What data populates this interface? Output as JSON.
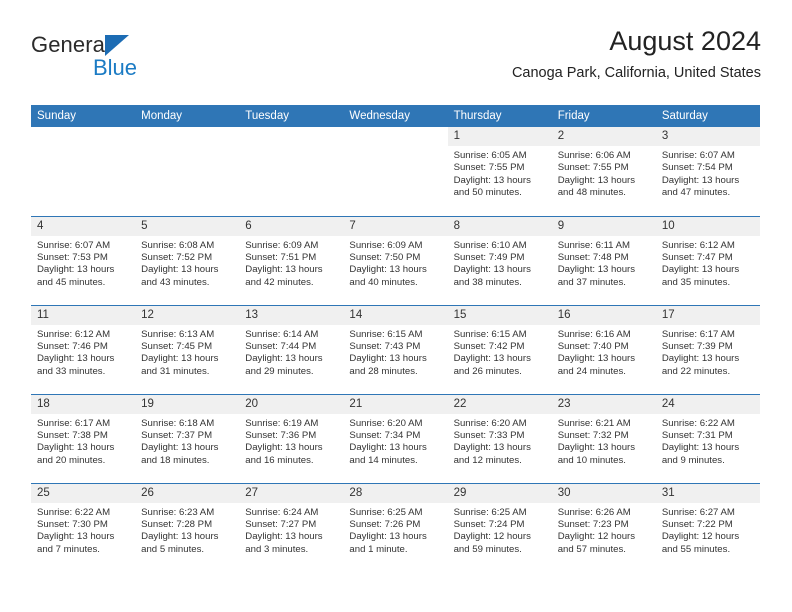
{
  "brand": {
    "name_part1": "General",
    "name_part2": "Blue",
    "triangle_color": "#1c6cb4",
    "blue_color": "#1b7bc4"
  },
  "header": {
    "title": "August 2024",
    "subtitle": "Canoga Park, California, United States"
  },
  "theme": {
    "header_bg": "#2f76b6",
    "daynum_bg": "#f0f0f0",
    "rule_color": "#2f76b6",
    "text_color": "#333333"
  },
  "weekday_headers": [
    "Sunday",
    "Monday",
    "Tuesday",
    "Wednesday",
    "Thursday",
    "Friday",
    "Saturday"
  ],
  "weeks": [
    [
      {
        "day": "",
        "empty": true,
        "sunrise": "",
        "sunset": "",
        "daylight1": "",
        "daylight2": ""
      },
      {
        "day": "",
        "empty": true,
        "sunrise": "",
        "sunset": "",
        "daylight1": "",
        "daylight2": ""
      },
      {
        "day": "",
        "empty": true,
        "sunrise": "",
        "sunset": "",
        "daylight1": "",
        "daylight2": ""
      },
      {
        "day": "",
        "empty": true,
        "sunrise": "",
        "sunset": "",
        "daylight1": "",
        "daylight2": ""
      },
      {
        "day": "1",
        "sunrise": "Sunrise: 6:05 AM",
        "sunset": "Sunset: 7:55 PM",
        "daylight1": "Daylight: 13 hours",
        "daylight2": "and 50 minutes."
      },
      {
        "day": "2",
        "sunrise": "Sunrise: 6:06 AM",
        "sunset": "Sunset: 7:55 PM",
        "daylight1": "Daylight: 13 hours",
        "daylight2": "and 48 minutes."
      },
      {
        "day": "3",
        "sunrise": "Sunrise: 6:07 AM",
        "sunset": "Sunset: 7:54 PM",
        "daylight1": "Daylight: 13 hours",
        "daylight2": "and 47 minutes."
      }
    ],
    [
      {
        "day": "4",
        "sunrise": "Sunrise: 6:07 AM",
        "sunset": "Sunset: 7:53 PM",
        "daylight1": "Daylight: 13 hours",
        "daylight2": "and 45 minutes."
      },
      {
        "day": "5",
        "sunrise": "Sunrise: 6:08 AM",
        "sunset": "Sunset: 7:52 PM",
        "daylight1": "Daylight: 13 hours",
        "daylight2": "and 43 minutes."
      },
      {
        "day": "6",
        "sunrise": "Sunrise: 6:09 AM",
        "sunset": "Sunset: 7:51 PM",
        "daylight1": "Daylight: 13 hours",
        "daylight2": "and 42 minutes."
      },
      {
        "day": "7",
        "sunrise": "Sunrise: 6:09 AM",
        "sunset": "Sunset: 7:50 PM",
        "daylight1": "Daylight: 13 hours",
        "daylight2": "and 40 minutes."
      },
      {
        "day": "8",
        "sunrise": "Sunrise: 6:10 AM",
        "sunset": "Sunset: 7:49 PM",
        "daylight1": "Daylight: 13 hours",
        "daylight2": "and 38 minutes."
      },
      {
        "day": "9",
        "sunrise": "Sunrise: 6:11 AM",
        "sunset": "Sunset: 7:48 PM",
        "daylight1": "Daylight: 13 hours",
        "daylight2": "and 37 minutes."
      },
      {
        "day": "10",
        "sunrise": "Sunrise: 6:12 AM",
        "sunset": "Sunset: 7:47 PM",
        "daylight1": "Daylight: 13 hours",
        "daylight2": "and 35 minutes."
      }
    ],
    [
      {
        "day": "11",
        "sunrise": "Sunrise: 6:12 AM",
        "sunset": "Sunset: 7:46 PM",
        "daylight1": "Daylight: 13 hours",
        "daylight2": "and 33 minutes."
      },
      {
        "day": "12",
        "sunrise": "Sunrise: 6:13 AM",
        "sunset": "Sunset: 7:45 PM",
        "daylight1": "Daylight: 13 hours",
        "daylight2": "and 31 minutes."
      },
      {
        "day": "13",
        "sunrise": "Sunrise: 6:14 AM",
        "sunset": "Sunset: 7:44 PM",
        "daylight1": "Daylight: 13 hours",
        "daylight2": "and 29 minutes."
      },
      {
        "day": "14",
        "sunrise": "Sunrise: 6:15 AM",
        "sunset": "Sunset: 7:43 PM",
        "daylight1": "Daylight: 13 hours",
        "daylight2": "and 28 minutes."
      },
      {
        "day": "15",
        "sunrise": "Sunrise: 6:15 AM",
        "sunset": "Sunset: 7:42 PM",
        "daylight1": "Daylight: 13 hours",
        "daylight2": "and 26 minutes."
      },
      {
        "day": "16",
        "sunrise": "Sunrise: 6:16 AM",
        "sunset": "Sunset: 7:40 PM",
        "daylight1": "Daylight: 13 hours",
        "daylight2": "and 24 minutes."
      },
      {
        "day": "17",
        "sunrise": "Sunrise: 6:17 AM",
        "sunset": "Sunset: 7:39 PM",
        "daylight1": "Daylight: 13 hours",
        "daylight2": "and 22 minutes."
      }
    ],
    [
      {
        "day": "18",
        "sunrise": "Sunrise: 6:17 AM",
        "sunset": "Sunset: 7:38 PM",
        "daylight1": "Daylight: 13 hours",
        "daylight2": "and 20 minutes."
      },
      {
        "day": "19",
        "sunrise": "Sunrise: 6:18 AM",
        "sunset": "Sunset: 7:37 PM",
        "daylight1": "Daylight: 13 hours",
        "daylight2": "and 18 minutes."
      },
      {
        "day": "20",
        "sunrise": "Sunrise: 6:19 AM",
        "sunset": "Sunset: 7:36 PM",
        "daylight1": "Daylight: 13 hours",
        "daylight2": "and 16 minutes."
      },
      {
        "day": "21",
        "sunrise": "Sunrise: 6:20 AM",
        "sunset": "Sunset: 7:34 PM",
        "daylight1": "Daylight: 13 hours",
        "daylight2": "and 14 minutes."
      },
      {
        "day": "22",
        "sunrise": "Sunrise: 6:20 AM",
        "sunset": "Sunset: 7:33 PM",
        "daylight1": "Daylight: 13 hours",
        "daylight2": "and 12 minutes."
      },
      {
        "day": "23",
        "sunrise": "Sunrise: 6:21 AM",
        "sunset": "Sunset: 7:32 PM",
        "daylight1": "Daylight: 13 hours",
        "daylight2": "and 10 minutes."
      },
      {
        "day": "24",
        "sunrise": "Sunrise: 6:22 AM",
        "sunset": "Sunset: 7:31 PM",
        "daylight1": "Daylight: 13 hours",
        "daylight2": "and 9 minutes."
      }
    ],
    [
      {
        "day": "25",
        "sunrise": "Sunrise: 6:22 AM",
        "sunset": "Sunset: 7:30 PM",
        "daylight1": "Daylight: 13 hours",
        "daylight2": "and 7 minutes."
      },
      {
        "day": "26",
        "sunrise": "Sunrise: 6:23 AM",
        "sunset": "Sunset: 7:28 PM",
        "daylight1": "Daylight: 13 hours",
        "daylight2": "and 5 minutes."
      },
      {
        "day": "27",
        "sunrise": "Sunrise: 6:24 AM",
        "sunset": "Sunset: 7:27 PM",
        "daylight1": "Daylight: 13 hours",
        "daylight2": "and 3 minutes."
      },
      {
        "day": "28",
        "sunrise": "Sunrise: 6:25 AM",
        "sunset": "Sunset: 7:26 PM",
        "daylight1": "Daylight: 13 hours",
        "daylight2": "and 1 minute."
      },
      {
        "day": "29",
        "sunrise": "Sunrise: 6:25 AM",
        "sunset": "Sunset: 7:24 PM",
        "daylight1": "Daylight: 12 hours",
        "daylight2": "and 59 minutes."
      },
      {
        "day": "30",
        "sunrise": "Sunrise: 6:26 AM",
        "sunset": "Sunset: 7:23 PM",
        "daylight1": "Daylight: 12 hours",
        "daylight2": "and 57 minutes."
      },
      {
        "day": "31",
        "sunrise": "Sunrise: 6:27 AM",
        "sunset": "Sunset: 7:22 PM",
        "daylight1": "Daylight: 12 hours",
        "daylight2": "and 55 minutes."
      }
    ]
  ]
}
